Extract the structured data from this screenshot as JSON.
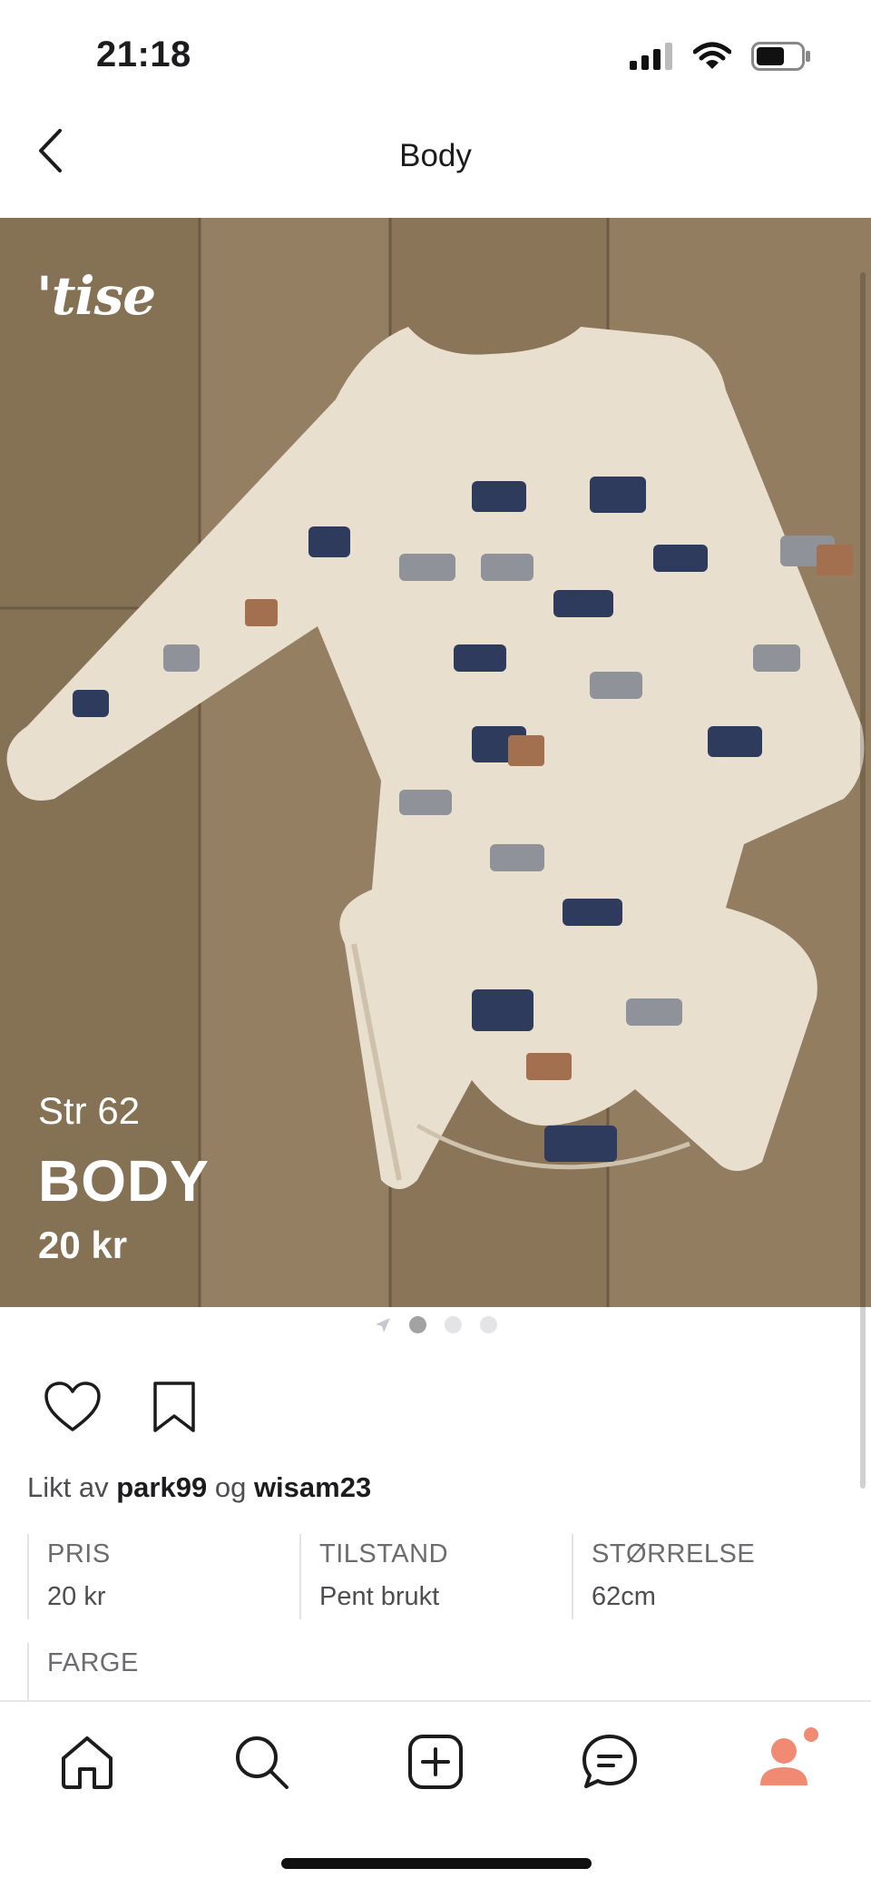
{
  "status": {
    "time": "21:18"
  },
  "nav": {
    "title": "Body"
  },
  "photo": {
    "brand": "'tise",
    "size_text": "Str 62",
    "title_text": "BODY",
    "price_text": "20 kr"
  },
  "pager": {
    "count": 3,
    "active_index": 0
  },
  "likes": {
    "prefix": "Likt av",
    "user1": "park99",
    "connector": "og",
    "user2": "wisam23"
  },
  "details": [
    {
      "label": "PRIS",
      "value": "20 kr"
    },
    {
      "label": "TILSTAND",
      "value": "Pent brukt"
    },
    {
      "label": "STØRRELSE",
      "value": "62cm"
    }
  ],
  "color": {
    "label": "FARGE"
  },
  "tabs": [
    {
      "name": "home",
      "icon": "home-icon"
    },
    {
      "name": "search",
      "icon": "search-icon"
    },
    {
      "name": "create",
      "icon": "plus-square-icon"
    },
    {
      "name": "messages",
      "icon": "chat-icon"
    },
    {
      "name": "profile",
      "icon": "profile-icon",
      "badge": true
    }
  ],
  "colors": {
    "accent": "#f08a72",
    "text": "#1c1c1e"
  }
}
